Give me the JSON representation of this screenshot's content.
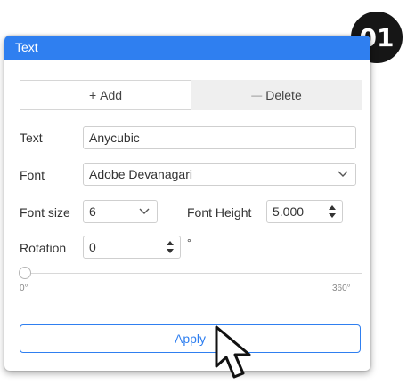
{
  "window": {
    "title": "Text"
  },
  "badge": {
    "text": "01"
  },
  "segmented": {
    "add_icon": "+",
    "add_label": "Add",
    "delete_icon": "—",
    "delete_label": "Delete"
  },
  "text_field": {
    "label": "Text",
    "value": "Anycubic"
  },
  "font_field": {
    "label": "Font",
    "value": "Adobe Devanagari"
  },
  "font_size": {
    "label": "Font size",
    "value": "6"
  },
  "font_height": {
    "label": "Font Height",
    "value": "5.000"
  },
  "rotation": {
    "label": "Rotation",
    "value": "0",
    "unit": "°"
  },
  "slider": {
    "min_label": "0°",
    "max_label": "360°",
    "value": 0
  },
  "apply_label": "Apply",
  "colors": {
    "accent": "#2f7ff0",
    "badge": "#161616"
  },
  "icons": [
    "chevron-down-icon",
    "spinner-arrows-icon",
    "mouse-pointer-icon"
  ]
}
